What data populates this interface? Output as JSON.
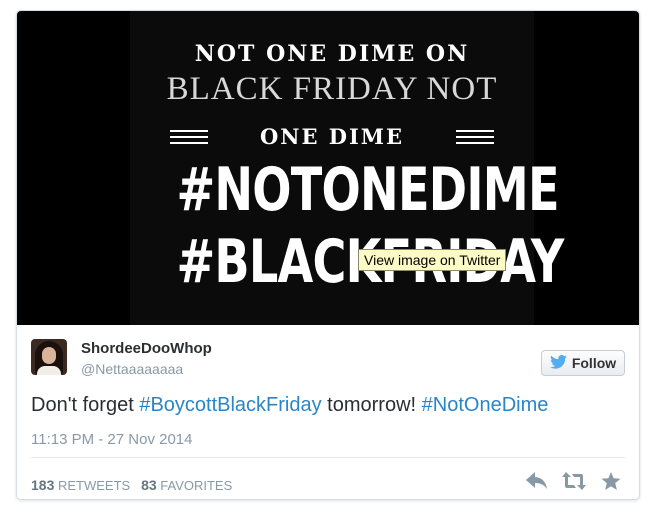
{
  "media": {
    "line1": "NOT ONE DIME ON",
    "line2": "BLACK FRIDAY NOT",
    "line3": "ONE DIME",
    "hashtag1": "#NOTONEDIME",
    "hashtag2": "#BLACKFRIDAY",
    "tooltip": "View image on Twitter"
  },
  "user": {
    "display_name": "ShordeeDooWhop",
    "handle": "@Nettaaaaaaaa"
  },
  "follow_button": {
    "label": "Follow",
    "icon": "bird-icon"
  },
  "tweet": {
    "text_1": "Don't forget ",
    "hashtag_1": "#BoycottBlackFriday",
    "text_2": " tomorrow! ",
    "hashtag_2": "#NotOneDime"
  },
  "timestamp": "11:13 PM - 27 Nov 2014",
  "stats": {
    "retweets_count": "183",
    "retweets_label": "RETWEETS",
    "favorites_count": "83",
    "favorites_label": "FAVORITES"
  },
  "actions": [
    "reply-icon",
    "retweet-icon",
    "favorite-icon"
  ],
  "colors": {
    "link": "#2a85c7",
    "muted": "#8899a6",
    "text": "#292f33",
    "twitter_blue": "#55acee"
  }
}
